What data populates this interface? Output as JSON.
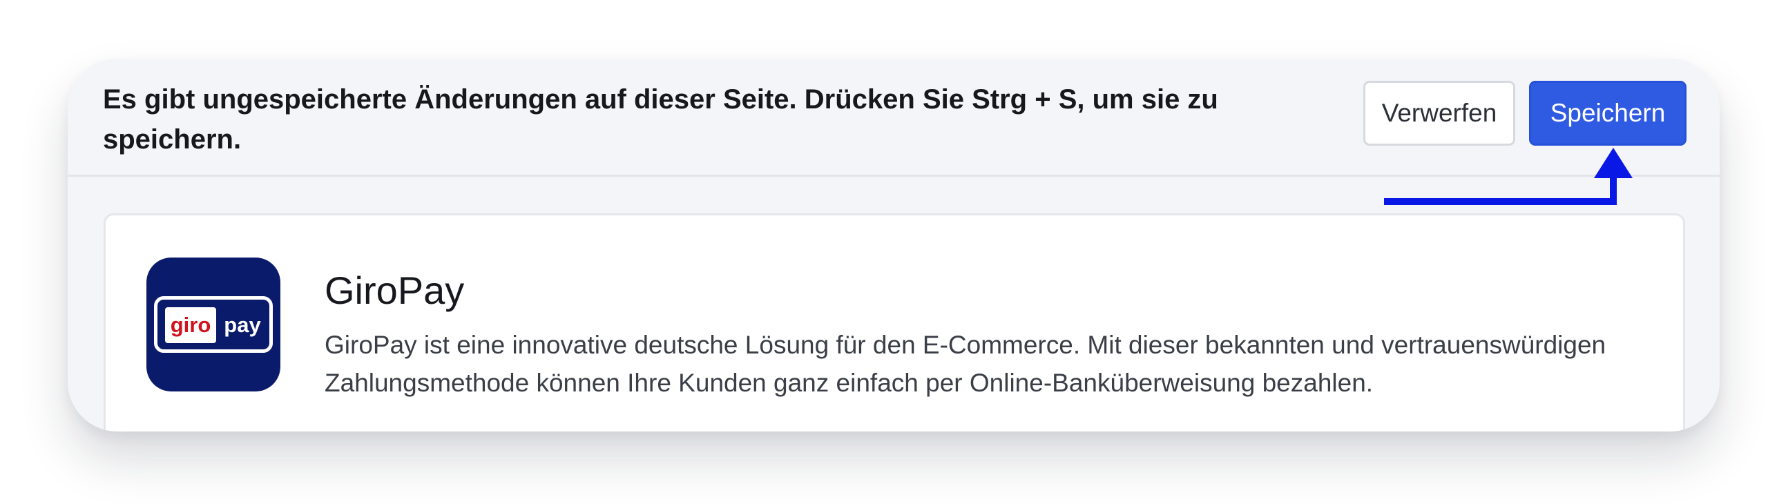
{
  "unsaved_bar": {
    "message": "Es gibt ungespeicherte Änderungen auf dieser Seite. Drücken Sie Strg + S, um sie zu speichern.",
    "discard_label": "Verwerfen",
    "save_label": "Speichern"
  },
  "payment_method": {
    "name": "GiroPay",
    "description": "GiroPay ist eine innovative deutsche Lösung für den E-Commerce. Mit dieser bekannten und vertrauenswürdigen Zahlungsmethode können Ihre Kunden ganz einfach per Online-Banküberweisung bezahlen.",
    "logo": {
      "left_text": "giro",
      "right_text": "pay"
    }
  },
  "colors": {
    "primary": "#2f5be3",
    "logo_background": "#0b1b6b",
    "logo_red": "#d0131c",
    "arrow": "#0a18e6"
  },
  "icons": {
    "hint_arrow": "up-arrow-icon"
  }
}
